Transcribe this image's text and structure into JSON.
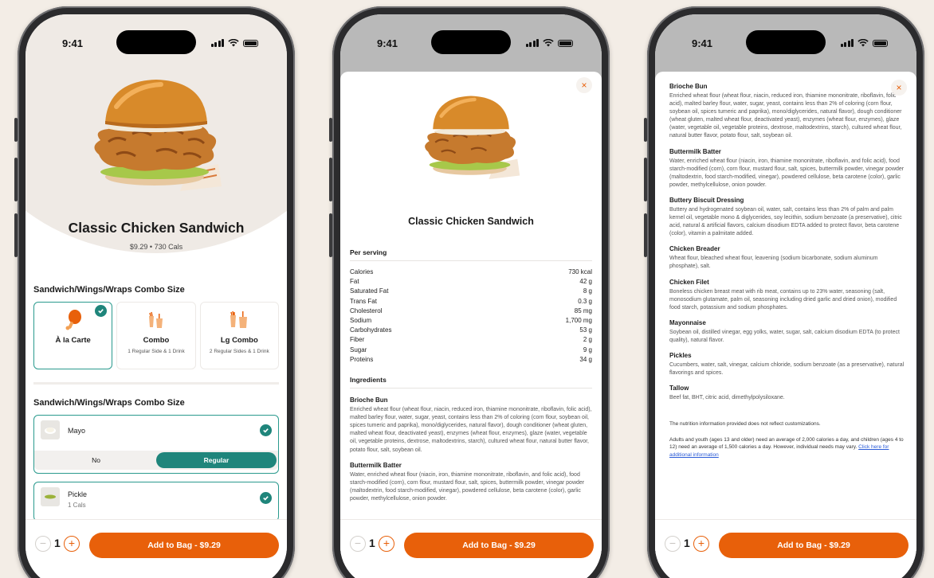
{
  "status": {
    "time": "9:41"
  },
  "product": {
    "name": "Classic Chicken Sandwich",
    "price_cal": "$9.29 • 730 Cals"
  },
  "combo_section": {
    "title": "Sandwich/Wings/Wraps Combo Size",
    "options": [
      {
        "name": "À la Carte",
        "desc": "",
        "selected": true
      },
      {
        "name": "Combo",
        "desc": "1 Regular Side & 1 Drink",
        "selected": false
      },
      {
        "name": "Lg Combo",
        "desc": "2 Regular Sides & 1 Drink",
        "selected": false
      }
    ]
  },
  "toppings_section": {
    "title": "Sandwich/Wings/Wraps Combo Size",
    "items": [
      {
        "name": "Mayo",
        "cals": "",
        "choices": [
          "No",
          "Regular"
        ],
        "selected_choice": "Regular"
      },
      {
        "name": "Pickle",
        "cals": "1 Cals"
      }
    ]
  },
  "cart": {
    "quantity": "1",
    "minus": "−",
    "plus": "+",
    "add_label": "Add to Bag - $9.29"
  },
  "modal": {
    "close": "×",
    "per_serving_title": "Per serving",
    "nutrition": [
      {
        "label": "Calories",
        "value": "730 kcal"
      },
      {
        "label": "Fat",
        "value": "42 g"
      },
      {
        "label": "Saturated Fat",
        "value": "8 g"
      },
      {
        "label": "Trans Fat",
        "value": "0.3 g"
      },
      {
        "label": "Cholesterol",
        "value": "85 mg"
      },
      {
        "label": "Sodium",
        "value": "1,700 mg"
      },
      {
        "label": "Carbohydrates",
        "value": "53 g"
      },
      {
        "label": "Fiber",
        "value": "2 g"
      },
      {
        "label": "Sugar",
        "value": "9 g"
      },
      {
        "label": "Proteins",
        "value": "34 g"
      }
    ],
    "ingredients_title": "Ingredients",
    "ingredients": [
      {
        "name": "Brioche Bun",
        "text": "Enriched wheat flour (wheat flour, niacin, reduced iron, thiamine mononitrate, riboflavin, folic acid), malted barley flour, water, sugar, yeast, contains less than 2% of coloring (corn flour, soybean oil, spices tumeric and paprika), mono/diglycerides, natural flavor), dough conditioner (wheat gluten, malted wheat flour, deactivated yeast), enzymes (wheat flour, enzymes), glaze (water, vegetable oil, vegetable proteins, dextrose, maltodextrins, starch), cultured wheat flour, natural butter flavor, potato flour, salt, soybean oil."
      },
      {
        "name": "Buttermilk Batter",
        "text": "Water, enriched wheat flour (niacin, iron, thiamine mononitrate, riboflavin, and folic acid), food starch-modified (corn), corn flour, mustard flour, salt, spices, buttermilk powder, vinegar powder (maltodextrin, food starch-modified, vinegar), powdered cellulose, beta carotene (color), garlic powder, methylcellulose, onion powder."
      },
      {
        "name": "Buttery Biscuit Dressing",
        "text": "Buttery and hydrogenated soybean oil, water, salt, contains less than 2% of palm and palm kernel oil, vegetable mono & diglycerides, soy lecithin, sodium benzoate (a preservative), citric acid, natural & artificial flavors, calcium disodium EDTA added to protect flavor, beta carotene (color), vitamin a palmitate added."
      },
      {
        "name": "Chicken Breader",
        "text": "Wheat flour, bleached wheat flour, leavening (sodium bicarbonate, sodium aluminum phosphate), salt."
      },
      {
        "name": "Chicken Filet",
        "text": "Boneless chicken breast meat with rib meat, contains up to 23% water, seasoning (salt, monosodium glutamate, palm oil, seasoning including dried garlic and dried onion), modified food starch, potassium and sodium phosphates."
      },
      {
        "name": "Mayonnaise",
        "text": "Soybean oil, distilled vinegar, egg yolks, water, sugar, salt, calcium disodium EDTA (to protect quality), natural flavor."
      },
      {
        "name": "Pickles",
        "text": "Cucumbers, water, salt, vinegar, calcium chloride, sodium benzoate (as a preservative), natural flavorings and spices."
      },
      {
        "name": "Tallow",
        "text": "Beef fat, BHT, citric acid, dimethylpolysiloxane."
      }
    ],
    "footnote": "The nutrition information provided does not reflect customizations.",
    "advice": "Adults and youth (ages 13 and older) need an average of 2,000 calories a day, and children (ages 4 to 12) need an average of 1,500 calories a day. However, individual needs may vary.",
    "advice_link": "Click here for additional information"
  },
  "colors": {
    "accent": "#e8600a",
    "teal": "#1f857b",
    "background": "#f3ede6"
  }
}
